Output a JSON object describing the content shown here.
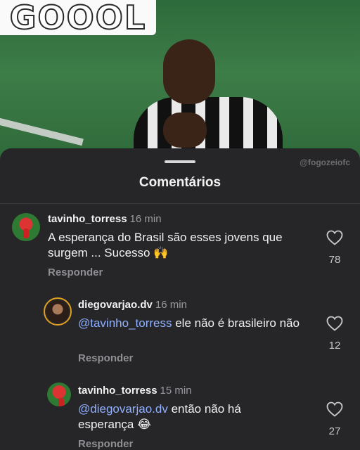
{
  "banner": {
    "text": "GOOOL"
  },
  "watermark": "@fogozeiofc",
  "sheet": {
    "title": "Comentários"
  },
  "comments": [
    {
      "username": "tavinho_torress",
      "time": "16 min",
      "text": "A esperança do Brasil são esses jovens que surgem ... Sucesso 🙌",
      "mention": "",
      "reply_label": "Responder",
      "likes": "78"
    },
    {
      "username": "diegovarjao.dv",
      "time": "16 min",
      "mention": "@tavinho_torress",
      "text": " ele não é brasileiro não",
      "reply_label": "Responder",
      "likes": "12"
    },
    {
      "username": "tavinho_torress",
      "time": "15 min",
      "mention": "@diegovarjao.dv",
      "text": " então não há esperança 😂",
      "reply_label": "Responder",
      "likes": "27"
    }
  ],
  "colors": {
    "sheet_bg": "#262629",
    "mention": "#8fb0ff",
    "secondary_text": "#8e8e93"
  },
  "icons": {
    "like": "heart-outline-icon"
  }
}
